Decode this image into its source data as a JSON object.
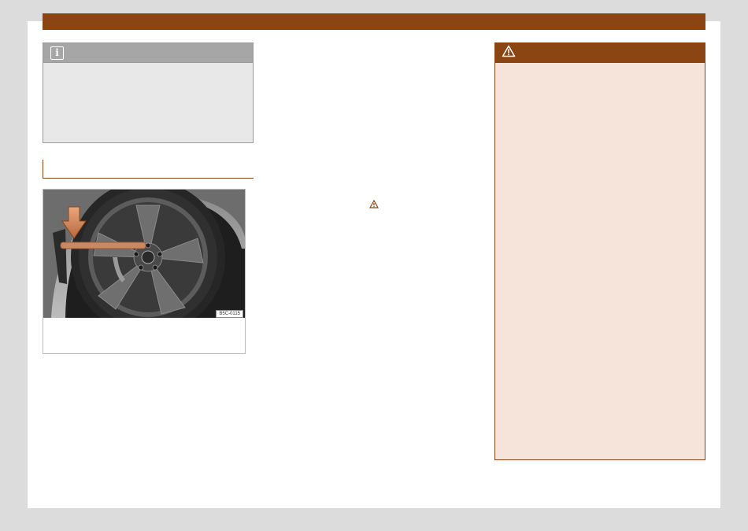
{
  "figure": {
    "code": "B5C-0115"
  },
  "icons": {
    "info": "info-icon",
    "warning": "warning-triangle-icon",
    "inline_warning": "warning-triangle-icon"
  },
  "colors": {
    "accent": "#8b4513",
    "note_background": "#e8e8e8",
    "note_header": "#a6a6a6",
    "warning_background": "#f6e4db"
  }
}
